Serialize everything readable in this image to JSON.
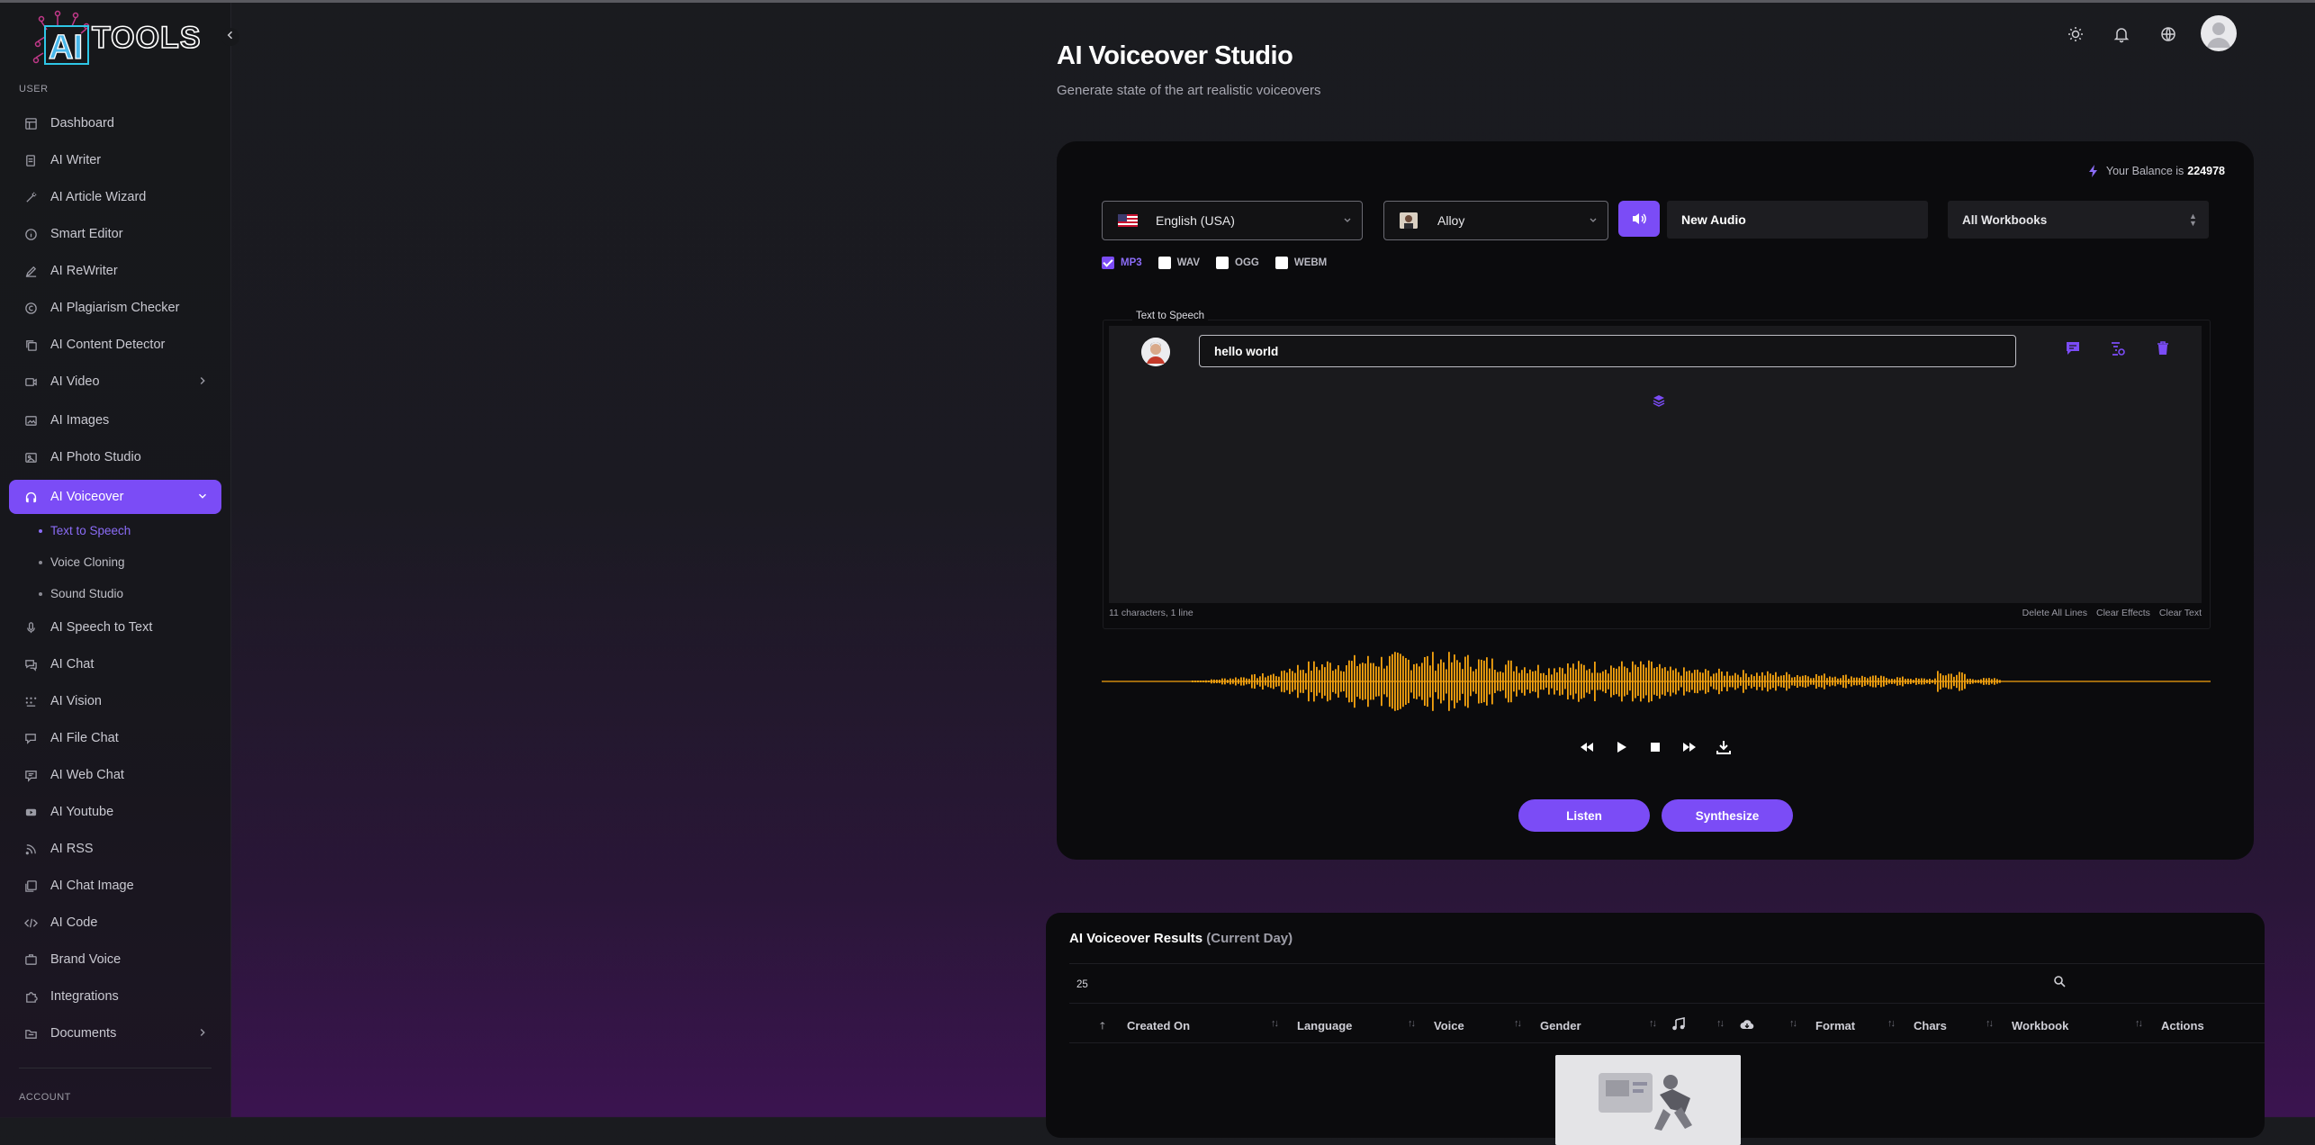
{
  "sidebar": {
    "logo": "AITOOLS",
    "section_user": "USER",
    "section_account": "ACCOUNT",
    "items": [
      {
        "label": "Dashboard"
      },
      {
        "label": "AI Writer"
      },
      {
        "label": "AI Article Wizard"
      },
      {
        "label": "Smart Editor"
      },
      {
        "label": "AI ReWriter"
      },
      {
        "label": "AI Plagiarism Checker"
      },
      {
        "label": "AI Content Detector"
      },
      {
        "label": "AI Video"
      },
      {
        "label": "AI Images"
      },
      {
        "label": "AI Photo Studio"
      },
      {
        "label": "AI Voiceover"
      },
      {
        "label": "AI Speech to Text"
      },
      {
        "label": "AI Chat"
      },
      {
        "label": "AI Vision"
      },
      {
        "label": "AI File Chat"
      },
      {
        "label": "AI Web Chat"
      },
      {
        "label": "AI Youtube"
      },
      {
        "label": "AI RSS"
      },
      {
        "label": "AI Chat Image"
      },
      {
        "label": "AI Code"
      },
      {
        "label": "Brand Voice"
      },
      {
        "label": "Integrations"
      },
      {
        "label": "Documents"
      }
    ],
    "subitems": [
      {
        "label": "Text to Speech"
      },
      {
        "label": "Voice Cloning"
      },
      {
        "label": "Sound Studio"
      }
    ]
  },
  "header": {
    "title": "AI Voiceover Studio",
    "subtitle": "Generate state of the art realistic voiceovers"
  },
  "studio": {
    "balance_label": "Your Balance is",
    "balance_value": "224978",
    "language": "English (USA)",
    "voice": "Alloy",
    "audio_title": "New Audio",
    "workbook": "All Workbooks",
    "formats": [
      {
        "label": "MP3",
        "checked": true
      },
      {
        "label": "WAV",
        "checked": false
      },
      {
        "label": "OGG",
        "checked": false
      },
      {
        "label": "WEBM",
        "checked": false
      }
    ],
    "tts_legend": "Text to Speech",
    "line_text": "hello world",
    "char_count": "11 characters, 1 line",
    "delete_all": "Delete All Lines",
    "clear_effects": "Clear Effects",
    "clear_text": "Clear Text",
    "listen": "Listen",
    "synthesize": "Synthesize"
  },
  "results": {
    "title": "AI Voiceover Results",
    "title_suffix": "(Current Day)",
    "page_size": "25",
    "columns": [
      "Created On",
      "Language",
      "Voice",
      "Gender",
      "Format",
      "Chars",
      "Workbook",
      "Actions"
    ]
  },
  "colors": {
    "accent": "#7b4cf6",
    "waveform": "#f5a30f"
  },
  "icons": [
    "theme-sun-icon",
    "bell-icon",
    "globe-icon",
    "speaker-icon",
    "bolt-icon",
    "search-icon",
    "music-note-icon",
    "cloud-icon"
  ]
}
